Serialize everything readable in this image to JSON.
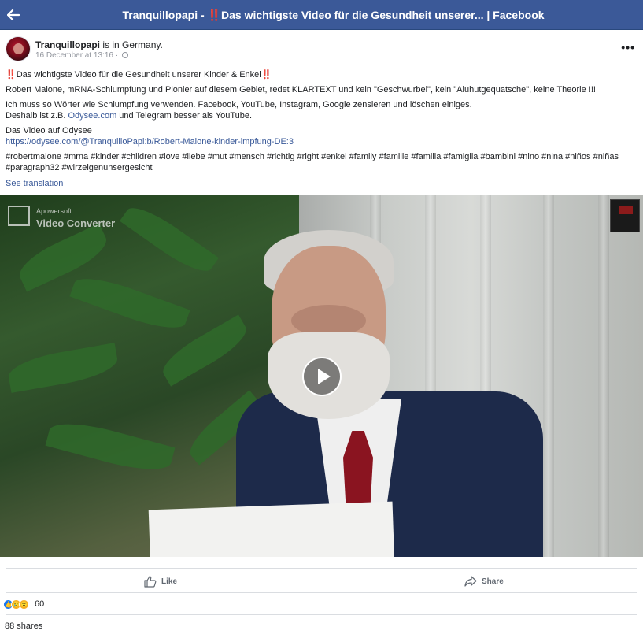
{
  "topbar": {
    "title": "Tranquillopapi - ‼️Das wichtigste Video für die Gesundheit unserer... | Facebook",
    "back_icon": "arrow-left-icon"
  },
  "colors": {
    "brand": "#3b5998",
    "link": "#385898",
    "text": "#1c1e21",
    "muted": "#90949c"
  },
  "post": {
    "author": "Tranquillopapi",
    "author_suffix": " is in Germany.",
    "timestamp": "16 December at 13:16",
    "time_sep": " · ",
    "more_label": "•••",
    "line1_bang": "‼️",
    "line1_text": "Das wichtigste Video für die Gesundheit unserer Kinder & Enkel",
    "line1_bang_end": "‼️",
    "line2": "Robert Malone, mRNA-Schlumpfung und Pionier auf diesem Gebiet, redet KLARTEXT und kein \"Geschwurbel\", kein \"Aluhutgequatsche\", keine Theorie !!!",
    "line3": "Ich muss so Wörter wie Schlumpfung verwenden. Facebook, YouTube, Instagram, Google zensieren und löschen einiges.",
    "line4_pre": "Deshalb ist z.B. ",
    "line4_link": "Odysee.com",
    "line4_post": " und Telegram besser als YouTube.",
    "line5": "Das Video auf Odysee",
    "video_link": "https://odysee.com/@TranquilloPapi:b/Robert-Malone-kinder-impfung-DE:3",
    "hashtags_line1": "#robertmalone #mrna #kinder #children #love #liebe #mut #mensch #richtig #right #enkel #family #familie #familia #famiglia #bambini #nino #nina #niños #niñas",
    "hashtags_line2": "#paragraph32 #wirzeigenunsergesicht",
    "see_translation": "See translation"
  },
  "video": {
    "watermark_brand": "Apowersoft",
    "watermark_product": "Video Converter",
    "play_icon": "play-icon"
  },
  "actions": {
    "like_label": "Like",
    "share_label": "Share",
    "like_icon": "thumbs-up-icon",
    "share_icon": "share-arrow-icon"
  },
  "stats": {
    "reactions": [
      "like-reaction-icon",
      "sad-reaction-icon",
      "wow-reaction-icon"
    ],
    "reaction_count": "60",
    "shares": "88 shares"
  }
}
